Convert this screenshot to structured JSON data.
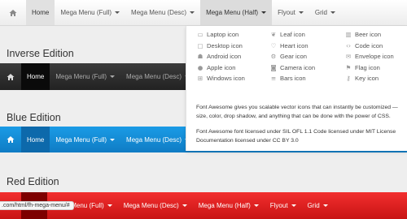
{
  "nav_items": {
    "home": "Home",
    "mega_full": "Mega Menu (Full)",
    "mega_desc": "Mega Menu (Desc)",
    "mega_half": "Mega Menu (Half)",
    "flyout": "Flyout",
    "grid": "Grid"
  },
  "sections": {
    "inverse_title": "Inverse Edition",
    "blue_title": "Blue Edition",
    "red_title": "Red Edition"
  },
  "mega_panel": {
    "icons": [
      {
        "icon": "laptop-icon",
        "label": "Laptop icon"
      },
      {
        "icon": "leaf-icon",
        "label": "Leaf icon"
      },
      {
        "icon": "beer-icon",
        "label": "Beer icon"
      },
      {
        "icon": "desktop-icon",
        "label": "Desktop icon"
      },
      {
        "icon": "heart-icon",
        "label": "Heart icon"
      },
      {
        "icon": "code-icon",
        "label": "Code icon"
      },
      {
        "icon": "android-icon",
        "label": "Android icon"
      },
      {
        "icon": "gear-icon",
        "label": "Gear icon"
      },
      {
        "icon": "envelope-icon",
        "label": "Envelope icon"
      },
      {
        "icon": "apple-icon",
        "label": "Apple icon"
      },
      {
        "icon": "camera-icon",
        "label": "Camera icon"
      },
      {
        "icon": "flag-icon",
        "label": "Flag icon"
      },
      {
        "icon": "windows-icon",
        "label": "Windows icon"
      },
      {
        "icon": "bars-icon",
        "label": "Bars icon"
      },
      {
        "icon": "key-icon",
        "label": "Key icon"
      }
    ],
    "description_1": "Font Awesome gives you scalable vector icons that can instantly be customized — size, color, drop shadow, and anything that can be done with the power of CSS.",
    "description_2": "Font Awesome font licensed under SIL OFL 1.1 Code licensed under MIT License Documentation licensed under CC BY 3.0"
  },
  "status_url": ".com/html/fh-mega-menu/#",
  "colors": {
    "inverse": "#222222",
    "blue": "#0f7cc4",
    "red": "#c81414"
  }
}
